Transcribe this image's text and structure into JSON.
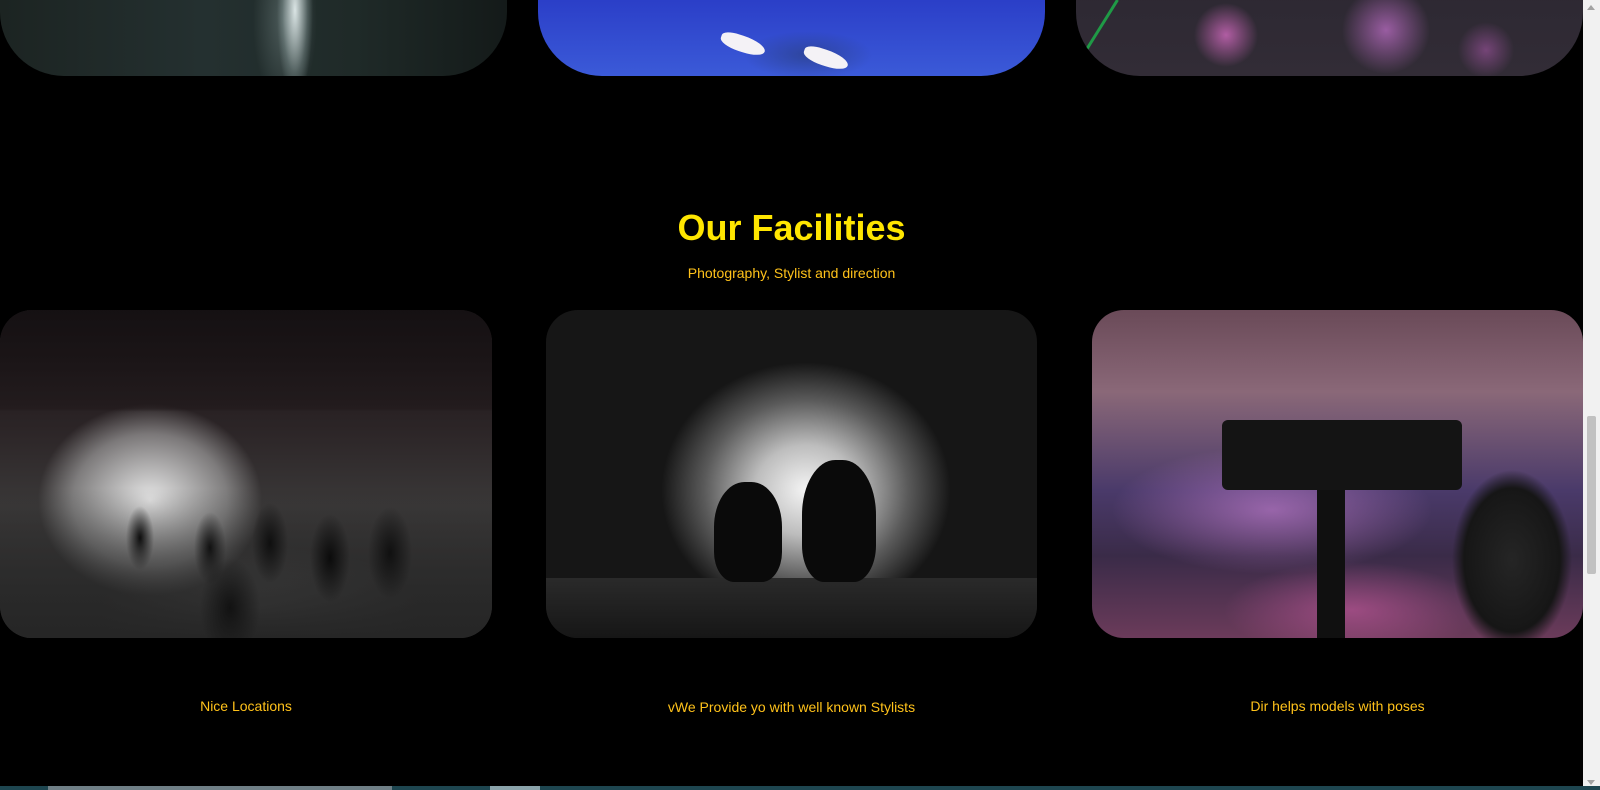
{
  "page": {
    "background": "#000000",
    "accent_title_color": "#ffe600",
    "accent_text_color": "#ffc21a"
  },
  "facilities": {
    "title": "Our Facilities",
    "subtitle": "Photography, Stylist and direction",
    "cards": [
      {
        "caption": "Nice Locations"
      },
      {
        "caption": "vWe Provide yo with well known Stylists"
      },
      {
        "caption": "Dir helps models with poses"
      }
    ]
  },
  "scrollbar": {
    "up_icon": "chevron-up-icon",
    "down_icon": "chevron-down-icon"
  }
}
